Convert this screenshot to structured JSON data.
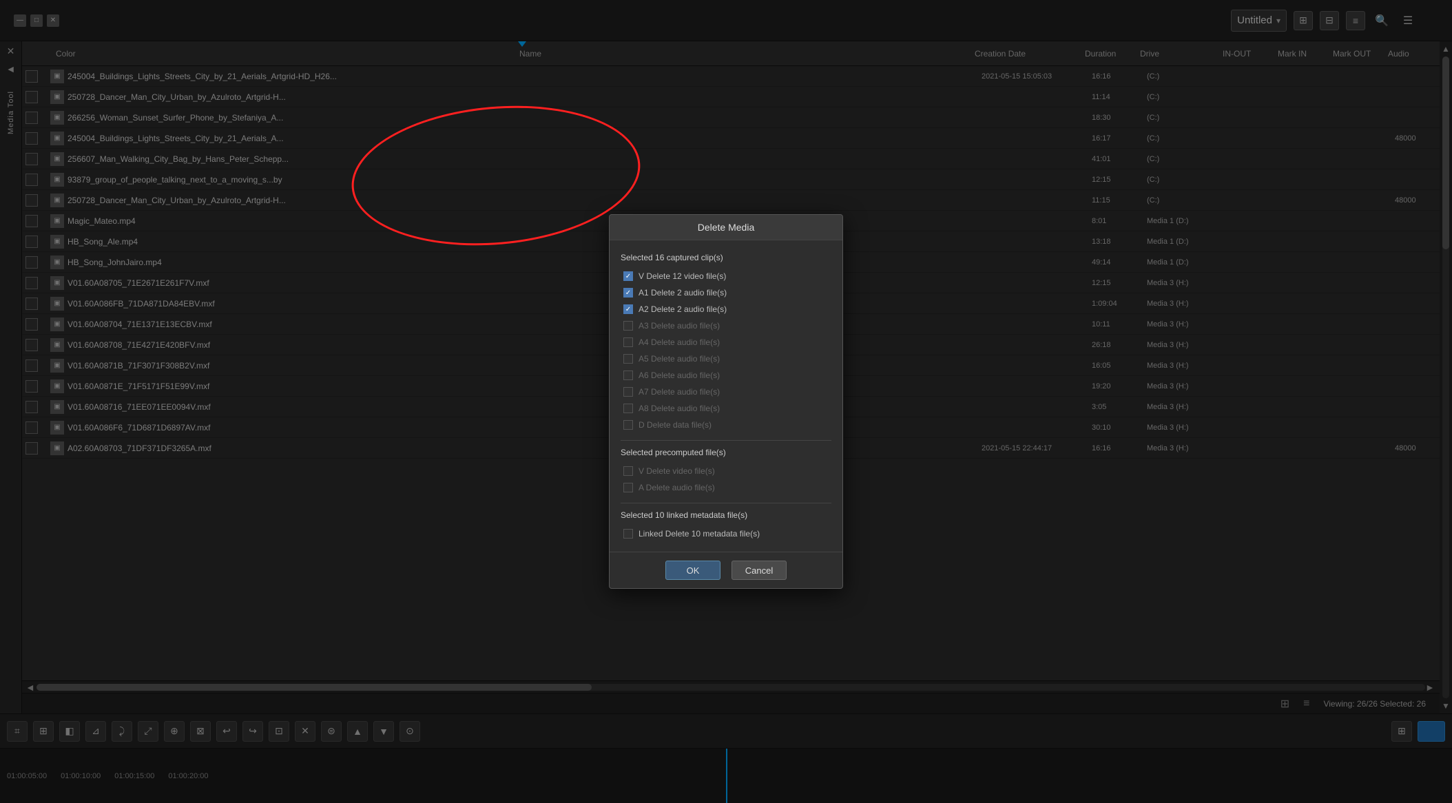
{
  "window": {
    "title": "Untitled",
    "min_label": "—",
    "max_label": "□",
    "close_label": "✕"
  },
  "header": {
    "title": "Untitled",
    "dropdown_arrow": "▾"
  },
  "table": {
    "columns": [
      "Color",
      "Name",
      "Creation Date",
      "Duration",
      "Drive",
      "IN-OUT",
      "Mark IN",
      "Mark OUT",
      "Audio"
    ],
    "rows": [
      {
        "checkbox": false,
        "icon": "▣",
        "name": "245004_Buildings_Lights_Streets_City_by_21_Aerials_Artgrid-HD_H26...",
        "creation": "2021-05-15 15:05:03",
        "duration": "16:16",
        "drive": "(C:)",
        "inout": "",
        "markin": "",
        "markout": "",
        "audio": ""
      },
      {
        "checkbox": false,
        "icon": "▣",
        "name": "250728_Dancer_Man_City_Urban_by_Azulroto_Artgrid-H...",
        "creation": "",
        "duration": "11:14",
        "drive": "(C:)",
        "inout": "",
        "markin": "",
        "markout": "",
        "audio": ""
      },
      {
        "checkbox": false,
        "icon": "▣",
        "name": "266256_Woman_Sunset_Surfer_Phone_by_Stefaniya_A...",
        "creation": "",
        "duration": "18:30",
        "drive": "(C:)",
        "inout": "",
        "markin": "",
        "markout": "",
        "audio": ""
      },
      {
        "checkbox": false,
        "icon": "▣",
        "name": "245004_Buildings_Lights_Streets_City_by_21_Aerials_A...",
        "creation": "",
        "duration": "16:17",
        "drive": "(C:)",
        "inout": "",
        "markin": "",
        "markout": "",
        "audio": "48000"
      },
      {
        "checkbox": false,
        "icon": "▣",
        "name": "256607_Man_Walking_City_Bag_by_Hans_Peter_Schepp...",
        "creation": "",
        "duration": "41:01",
        "drive": "(C:)",
        "inout": "",
        "markin": "",
        "markout": "",
        "audio": ""
      },
      {
        "checkbox": false,
        "icon": "▣",
        "name": "93879_group_of_people_talking_next_to_a_moving_s...by",
        "creation": "",
        "duration": "12:15",
        "drive": "(C:)",
        "inout": "",
        "markin": "",
        "markout": "",
        "audio": ""
      },
      {
        "checkbox": false,
        "icon": "▣",
        "name": "250728_Dancer_Man_City_Urban_by_Azulroto_Artgrid-H...",
        "creation": "",
        "duration": "11:15",
        "drive": "(C:)",
        "inout": "",
        "markin": "",
        "markout": "",
        "audio": "48000"
      },
      {
        "checkbox": false,
        "icon": "▣",
        "name": "Magic_Mateo.mp4",
        "creation": "",
        "duration": "8:01",
        "drive": "Media 1 (D:)",
        "inout": "",
        "markin": "",
        "markout": "",
        "audio": ""
      },
      {
        "checkbox": false,
        "icon": "▣",
        "name": "HB_Song_Ale.mp4",
        "creation": "",
        "duration": "13:18",
        "drive": "Media 1 (D:)",
        "inout": "",
        "markin": "",
        "markout": "",
        "audio": ""
      },
      {
        "checkbox": false,
        "icon": "▣",
        "name": "HB_Song_JohnJairo.mp4",
        "creation": "",
        "duration": "49:14",
        "drive": "Media 1 (D:)",
        "inout": "",
        "markin": "",
        "markout": "",
        "audio": ""
      },
      {
        "checkbox": false,
        "icon": "▣",
        "name": "V01.60A08705_71E2671E261F7V.mxf",
        "creation": "",
        "duration": "12:15",
        "drive": "Media 3 (H:)",
        "inout": "",
        "markin": "",
        "markout": "",
        "audio": ""
      },
      {
        "checkbox": false,
        "icon": "▣",
        "name": "V01.60A086FB_71DA871DA84EBV.mxf",
        "creation": "",
        "duration": "1:09:04",
        "drive": "Media 3 (H:)",
        "inout": "",
        "markin": "",
        "markout": "",
        "audio": ""
      },
      {
        "checkbox": false,
        "icon": "▣",
        "name": "V01.60A08704_71E1371E13ECBV.mxf",
        "creation": "",
        "duration": "10:11",
        "drive": "Media 3 (H:)",
        "inout": "",
        "markin": "",
        "markout": "",
        "audio": ""
      },
      {
        "checkbox": false,
        "icon": "▣",
        "name": "V01.60A08708_71E4271E420BFV.mxf",
        "creation": "",
        "duration": "26:18",
        "drive": "Media 3 (H:)",
        "inout": "",
        "markin": "",
        "markout": "",
        "audio": ""
      },
      {
        "checkbox": false,
        "icon": "▣",
        "name": "V01.60A0871B_71F3071F308B2V.mxf",
        "creation": "",
        "duration": "16:05",
        "drive": "Media 3 (H:)",
        "inout": "",
        "markin": "",
        "markout": "",
        "audio": ""
      },
      {
        "checkbox": false,
        "icon": "▣",
        "name": "V01.60A0871E_71F5171F51E99V.mxf",
        "creation": "",
        "duration": "19:20",
        "drive": "Media 3 (H:)",
        "inout": "",
        "markin": "",
        "markout": "",
        "audio": ""
      },
      {
        "checkbox": false,
        "icon": "▣",
        "name": "V01.60A08716_71EE071EE0094V.mxf",
        "creation": "",
        "duration": "3:05",
        "drive": "Media 3 (H:)",
        "inout": "",
        "markin": "",
        "markout": "",
        "audio": ""
      },
      {
        "checkbox": false,
        "icon": "▣",
        "name": "V01.60A086F6_71D6871D6897AV.mxf",
        "creation": "",
        "duration": "30:10",
        "drive": "Media 3 (H:)",
        "inout": "",
        "markin": "",
        "markout": "",
        "audio": ""
      },
      {
        "checkbox": false,
        "icon": "▣",
        "name": "A02.60A08703_71DF371DF3265A.mxf",
        "creation": "2021-05-15 22:44:17",
        "duration": "16:16",
        "drive": "Media 3 (H:)",
        "inout": "",
        "markin": "",
        "markout": "",
        "audio": "48000"
      }
    ]
  },
  "dialog": {
    "title": "Delete Media",
    "selected_captured_label": "Selected  16  captured clip(s)",
    "captured_checks": [
      {
        "id": "v",
        "label": "V   Delete  12  video file(s)",
        "checked": true,
        "enabled": true
      },
      {
        "id": "a1",
        "label": "A1  Delete  2  audio file(s)",
        "checked": true,
        "enabled": true
      },
      {
        "id": "a2",
        "label": "A2  Delete  2  audio file(s)",
        "checked": true,
        "enabled": true
      },
      {
        "id": "a3",
        "label": "A3  Delete audio file(s)",
        "checked": false,
        "enabled": false
      },
      {
        "id": "a4",
        "label": "A4  Delete audio file(s)",
        "checked": false,
        "enabled": false
      },
      {
        "id": "a5",
        "label": "A5  Delete audio file(s)",
        "checked": false,
        "enabled": false
      },
      {
        "id": "a6",
        "label": "A6  Delete audio file(s)",
        "checked": false,
        "enabled": false
      },
      {
        "id": "a7",
        "label": "A7  Delete audio file(s)",
        "checked": false,
        "enabled": false
      },
      {
        "id": "a8",
        "label": "A8  Delete audio file(s)",
        "checked": false,
        "enabled": false
      },
      {
        "id": "d",
        "label": "D   Delete data file(s)",
        "checked": false,
        "enabled": false
      }
    ],
    "precomputed_label": "Selected precomputed file(s)",
    "precomputed_checks": [
      {
        "id": "pv",
        "label": "V   Delete video file(s)",
        "checked": false,
        "enabled": false
      },
      {
        "id": "pa",
        "label": "A   Delete audio file(s)",
        "checked": false,
        "enabled": false
      }
    ],
    "linked_label": "Selected  10  linked metadata file(s)",
    "linked_check_label": "Linked  Delete  10  metadata file(s)",
    "linked_checked": false,
    "ok_label": "OK",
    "cancel_label": "Cancel"
  },
  "status_bar": {
    "viewing": "Viewing: 26/26  Selected: 26"
  },
  "timeline": {
    "markers": [
      "01:00:05:00",
      "01:00:10:00",
      "01:00:15:00",
      "01:00:20:00"
    ],
    "current_time": "01:00:05:00"
  },
  "sidebar": {
    "close_icon": "✕",
    "arrow_icon": "◄",
    "media_tool_label": "Media Tool"
  },
  "toolbar_icons": [
    "⌗",
    "⊞",
    "◧",
    "⊿",
    "⟳",
    "⤢",
    "⊕",
    "⊠",
    "⊡",
    "⟵",
    "⤸",
    "⌛",
    "▲",
    "⊜",
    "⊙"
  ]
}
